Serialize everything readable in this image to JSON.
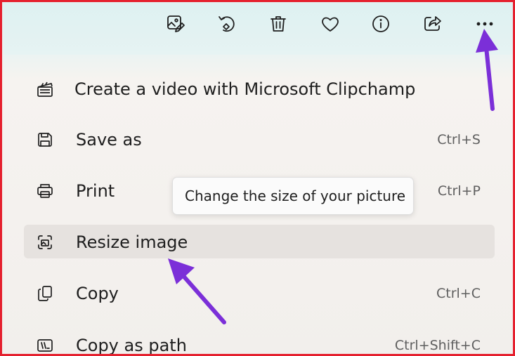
{
  "toolbar": {
    "icons": [
      "edit-image-icon",
      "rotate-icon",
      "delete-icon",
      "favorite-icon",
      "info-icon",
      "share-icon",
      "more-options-icon"
    ]
  },
  "menu": {
    "items": [
      {
        "label": "Create a video with Microsoft Clipchamp",
        "shortcut": "",
        "icon": "clipchamp-icon"
      },
      {
        "label": "Save as",
        "shortcut": "Ctrl+S",
        "icon": "save-icon"
      },
      {
        "label": "Print",
        "shortcut": "Ctrl+P",
        "icon": "print-icon"
      },
      {
        "label": "Resize image",
        "shortcut": "",
        "icon": "resize-icon"
      },
      {
        "label": "Copy",
        "shortcut": "Ctrl+C",
        "icon": "copy-icon"
      },
      {
        "label": "Copy as path",
        "shortcut": "Ctrl+Shift+C",
        "icon": "copy-path-icon"
      }
    ]
  },
  "tooltip": {
    "text": "Change the size of your picture"
  },
  "colors": {
    "border": "#e5202e",
    "annotation_arrow": "#7b2fd8",
    "hover": "#e6e2df"
  }
}
